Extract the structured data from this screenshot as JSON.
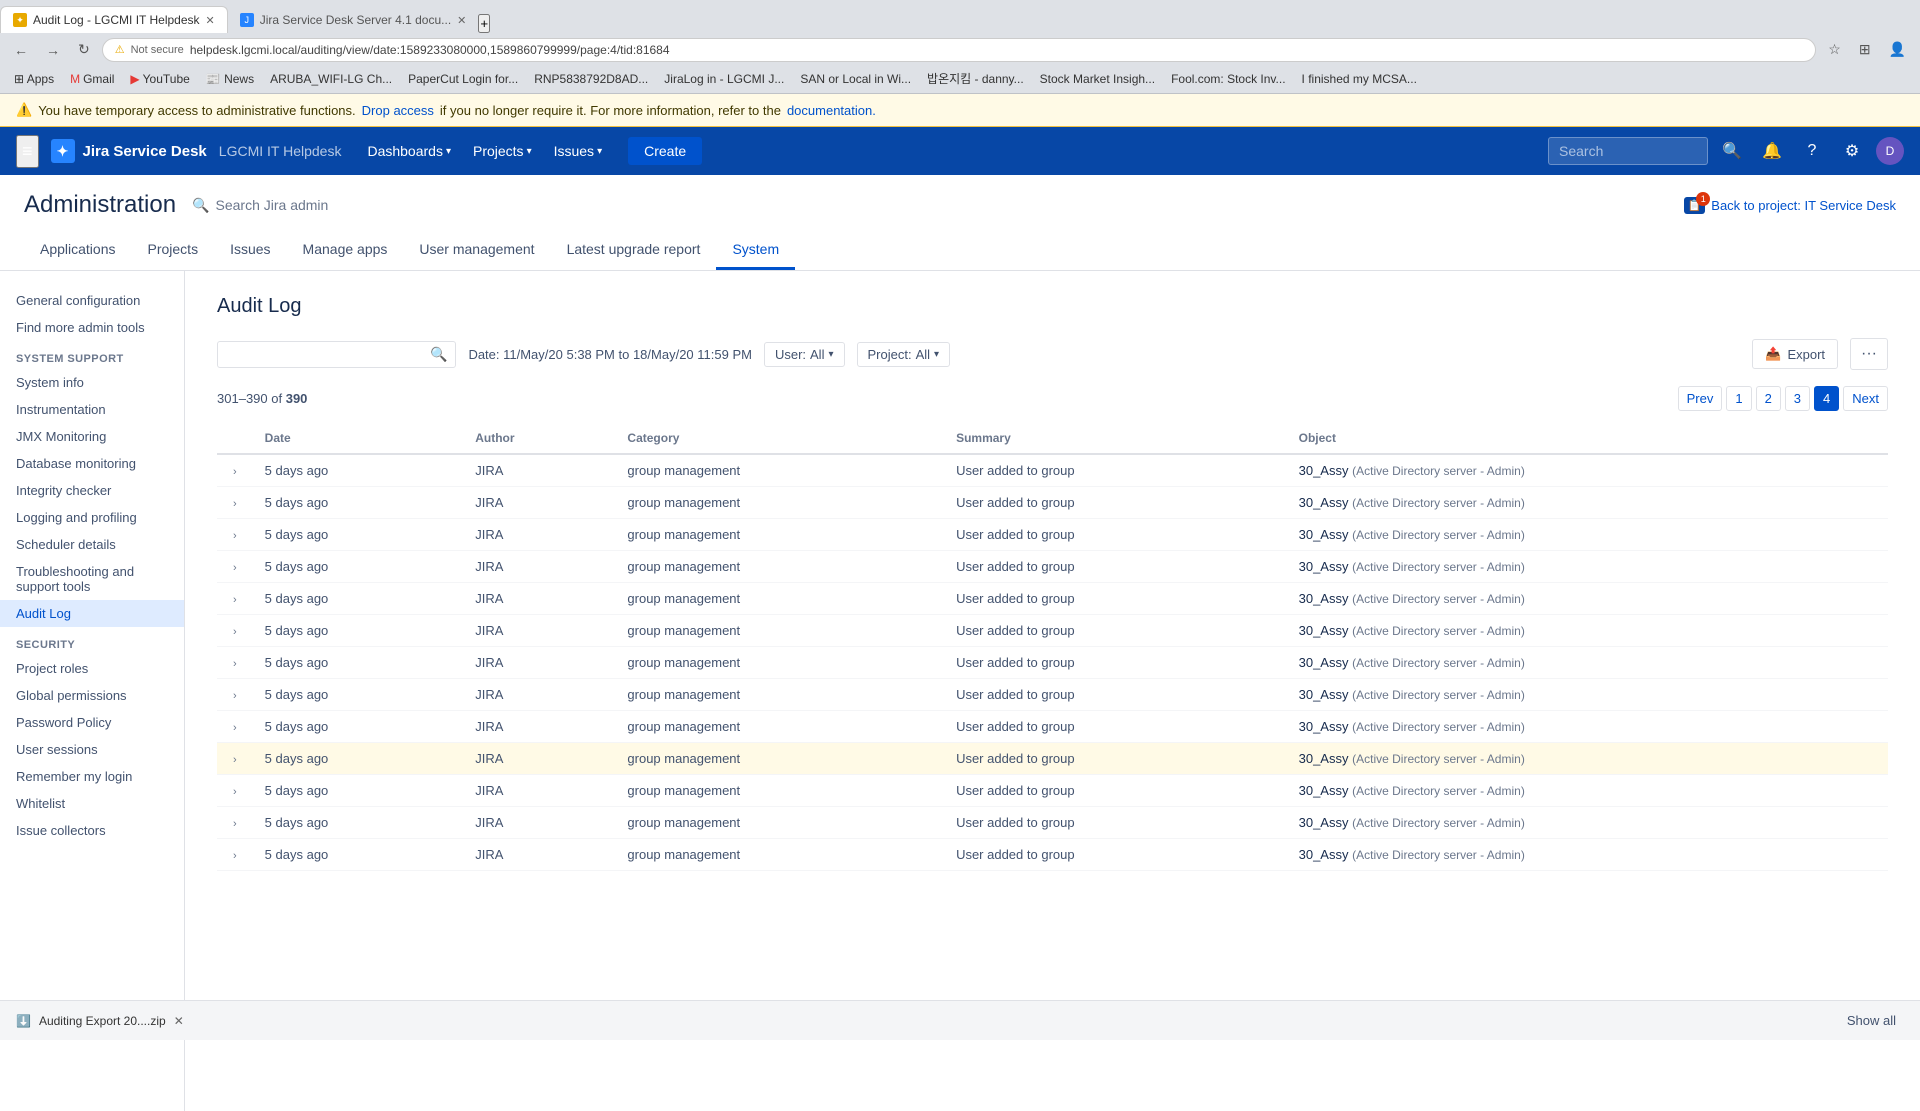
{
  "browser": {
    "tabs": [
      {
        "label": "Audit Log - LGCMI IT Helpdesk",
        "active": true,
        "favicon_color": "#e8a900"
      },
      {
        "label": "Jira Service Desk Server 4.1 docu...",
        "active": false,
        "favicon_color": "#2684ff"
      }
    ],
    "url": "helpdesk.lgcmi.local/auditing/view/date:1589233080000,1589860799999/page:4/tid:81684",
    "lock_icon": "⚠",
    "not_secure": "Not secure"
  },
  "bookmarks": [
    {
      "label": "Apps"
    },
    {
      "label": "Gmail"
    },
    {
      "label": "YouTube"
    },
    {
      "label": "News"
    },
    {
      "label": "ARUBA_WIFI-LG Ch..."
    },
    {
      "label": "PaperCut Login for..."
    },
    {
      "label": "RNP5838792D8AD..."
    },
    {
      "label": "JiraLog in - LGCMI J..."
    },
    {
      "label": "SAN or Local in Wi..."
    },
    {
      "label": "밥온지킴 - danny..."
    },
    {
      "label": "Stock Market Insigh..."
    },
    {
      "label": "Fool.com: Stock Inv..."
    },
    {
      "label": "I finished my MCSA..."
    }
  ],
  "warning_banner": {
    "text_before": "You have temporary access to administrative functions.",
    "link_text": "Drop access",
    "text_middle": "if you no longer require it. For more information, refer to the",
    "doc_link": "documentation."
  },
  "topnav": {
    "logo_letter": "✦",
    "app_name": "Jira Service Desk",
    "instance_name": "LGCMI IT Helpdesk",
    "links": [
      {
        "label": "Dashboards",
        "has_arrow": true
      },
      {
        "label": "Projects",
        "has_arrow": true
      },
      {
        "label": "Issues",
        "has_arrow": true
      }
    ],
    "create_label": "Create",
    "search_placeholder": "Search",
    "icons": [
      "bell-icon",
      "help-icon",
      "settings-icon"
    ],
    "avatar_letter": "D"
  },
  "admin_header": {
    "title": "Administration",
    "search_placeholder": "Search Jira admin",
    "back_label": "Back to project: IT Service Desk",
    "notification_count": "1",
    "tabs": [
      {
        "label": "Applications"
      },
      {
        "label": "Projects"
      },
      {
        "label": "Issues"
      },
      {
        "label": "Manage apps"
      },
      {
        "label": "User management"
      },
      {
        "label": "Latest upgrade report"
      },
      {
        "label": "System",
        "active": true
      }
    ]
  },
  "sidebar": {
    "general_items": [
      {
        "label": "General configuration"
      },
      {
        "label": "Find more admin tools"
      }
    ],
    "system_support_header": "SYSTEM SUPPORT",
    "system_support_items": [
      {
        "label": "System info"
      },
      {
        "label": "Instrumentation"
      },
      {
        "label": "JMX Monitoring"
      },
      {
        "label": "Database monitoring"
      },
      {
        "label": "Integrity checker"
      },
      {
        "label": "Logging and profiling"
      },
      {
        "label": "Scheduler details"
      },
      {
        "label": "Troubleshooting and support tools"
      },
      {
        "label": "Audit Log",
        "active": true
      }
    ],
    "security_header": "SECURITY",
    "security_items": [
      {
        "label": "Project roles"
      },
      {
        "label": "Global permissions"
      },
      {
        "label": "Password Policy"
      },
      {
        "label": "User sessions"
      },
      {
        "label": "Remember my login"
      },
      {
        "label": "Whitelist"
      },
      {
        "label": "Issue collectors"
      }
    ]
  },
  "audit_log": {
    "title": "Audit Log",
    "search_placeholder": "",
    "date_filter": "Date: 11/May/20 5:38 PM to 18/May/20 11:59 PM",
    "user_filter_label": "User:",
    "user_filter_value": "All",
    "project_filter_label": "Project:",
    "project_filter_value": "All",
    "export_label": "Export",
    "pagination": {
      "range_start": "301",
      "range_end": "390",
      "total": "390",
      "prev_label": "Prev",
      "next_label": "Next",
      "pages": [
        "1",
        "2",
        "3",
        "4"
      ]
    },
    "table_headers": [
      "Date",
      "Author",
      "Category",
      "Summary",
      "Object"
    ],
    "rows": [
      {
        "date": "5 days ago",
        "author": "JIRA",
        "category": "group management",
        "summary": "User added to group",
        "object_primary": "30_Assy",
        "object_secondary": "(Active Directory server - Admin)",
        "highlighted": false
      },
      {
        "date": "5 days ago",
        "author": "JIRA",
        "category": "group management",
        "summary": "User added to group",
        "object_primary": "30_Assy",
        "object_secondary": "(Active Directory server - Admin)",
        "highlighted": false
      },
      {
        "date": "5 days ago",
        "author": "JIRA",
        "category": "group management",
        "summary": "User added to group",
        "object_primary": "30_Assy",
        "object_secondary": "(Active Directory server - Admin)",
        "highlighted": false
      },
      {
        "date": "5 days ago",
        "author": "JIRA",
        "category": "group management",
        "summary": "User added to group",
        "object_primary": "30_Assy",
        "object_secondary": "(Active Directory server - Admin)",
        "highlighted": false
      },
      {
        "date": "5 days ago",
        "author": "JIRA",
        "category": "group management",
        "summary": "User added to group",
        "object_primary": "30_Assy",
        "object_secondary": "(Active Directory server - Admin)",
        "highlighted": false
      },
      {
        "date": "5 days ago",
        "author": "JIRA",
        "category": "group management",
        "summary": "User added to group",
        "object_primary": "30_Assy",
        "object_secondary": "(Active Directory server - Admin)",
        "highlighted": false
      },
      {
        "date": "5 days ago",
        "author": "JIRA",
        "category": "group management",
        "summary": "User added to group",
        "object_primary": "30_Assy",
        "object_secondary": "(Active Directory server - Admin)",
        "highlighted": false
      },
      {
        "date": "5 days ago",
        "author": "JIRA",
        "category": "group management",
        "summary": "User added to group",
        "object_primary": "30_Assy",
        "object_secondary": "(Active Directory server - Admin)",
        "highlighted": false
      },
      {
        "date": "5 days ago",
        "author": "JIRA",
        "category": "group management",
        "summary": "User added to group",
        "object_primary": "30_Assy",
        "object_secondary": "(Active Directory server - Admin)",
        "highlighted": false
      },
      {
        "date": "5 days ago",
        "author": "JIRA",
        "category": "group management",
        "summary": "User added to group",
        "object_primary": "30_Assy",
        "object_secondary": "(Active Directory server - Admin)",
        "highlighted": true
      },
      {
        "date": "5 days ago",
        "author": "JIRA",
        "category": "group management",
        "summary": "User added to group",
        "object_primary": "30_Assy",
        "object_secondary": "(Active Directory server - Admin)",
        "highlighted": false
      },
      {
        "date": "5 days ago",
        "author": "JIRA",
        "category": "group management",
        "summary": "User added to group",
        "object_primary": "30_Assy",
        "object_secondary": "(Active Directory server - Admin)",
        "highlighted": false
      },
      {
        "date": "5 days ago",
        "author": "JIRA",
        "category": "group management",
        "summary": "User added to group",
        "object_primary": "30_Assy",
        "object_secondary": "(Active Directory server - Admin)",
        "highlighted": false
      }
    ]
  },
  "bottom_bar": {
    "download_filename": "Auditing Export 20....zip",
    "show_all_label": "Show all"
  }
}
